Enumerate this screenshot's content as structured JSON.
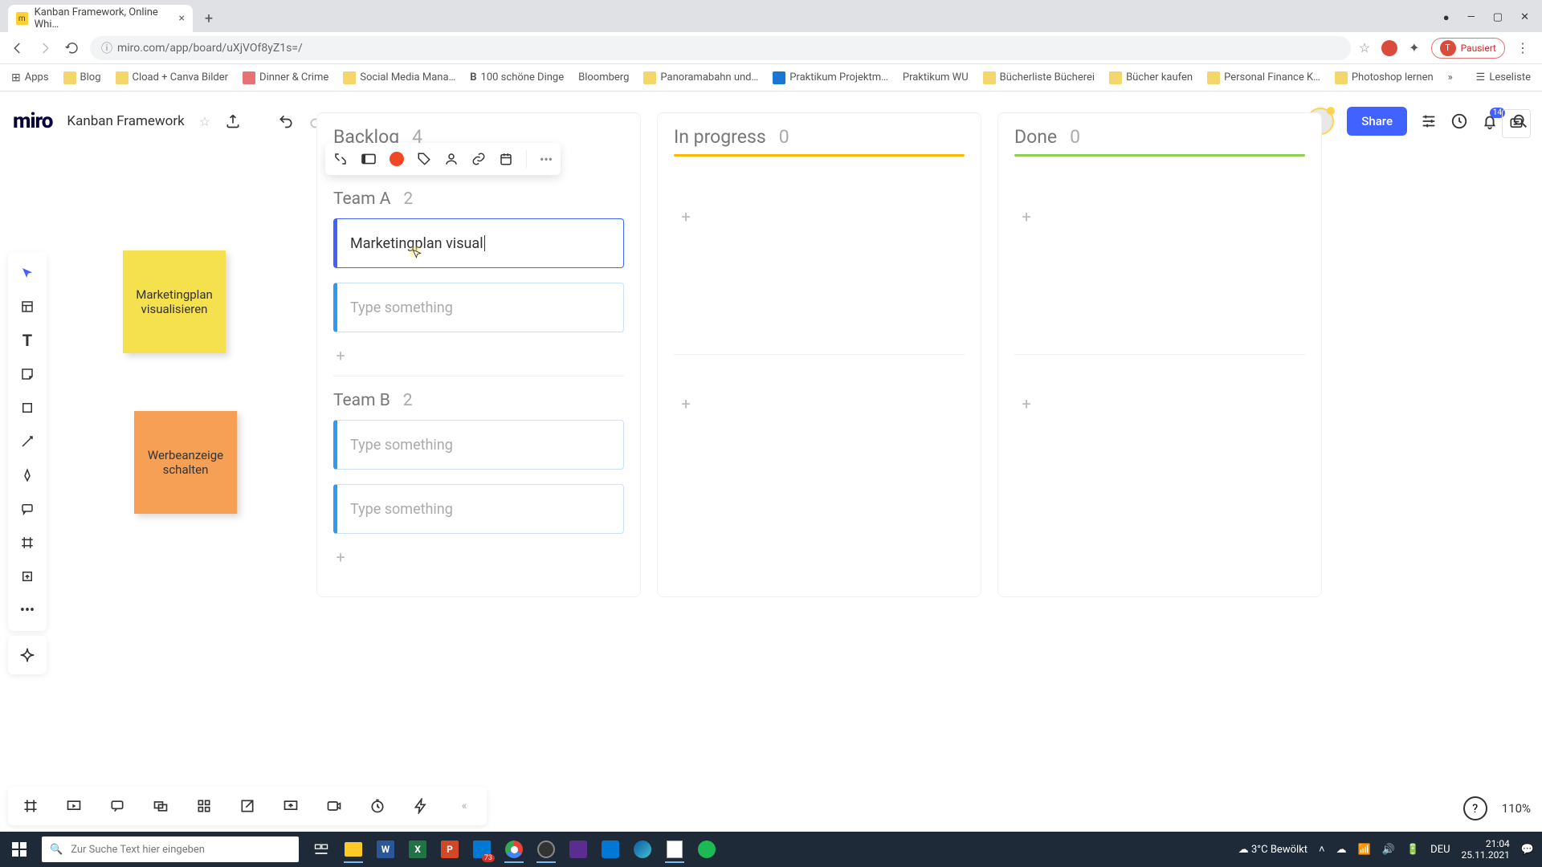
{
  "browser": {
    "tab_title": "Kanban Framework, Online Whi…",
    "url": "miro.com/app/board/uXjVOf8yZ1s=/",
    "profile_status": "Pausiert",
    "profile_initial": "T",
    "bookmarks": [
      "Apps",
      "Blog",
      "Cload + Canva Bilder",
      "Dinner & Crime",
      "Social Media Mana…",
      "100 schöne Dinge",
      "Bloomberg",
      "Panoramabahn und…",
      "Praktikum Projektm…",
      "Praktikum WU",
      "Bücherliste Bücherei",
      "Bücher kaufen",
      "Personal Finance K…",
      "Photoshop lernen"
    ],
    "reading_list": "Leseliste"
  },
  "app": {
    "logo": "miro",
    "board_title": "Kanban Framework",
    "share_label": "Share",
    "notification_count": "14",
    "zoom": "110%"
  },
  "stickies": {
    "yellow": "Marketingplan visualisieren",
    "orange": "Werbeanzeige schalten"
  },
  "kanban": {
    "columns": [
      {
        "title": "Backlog",
        "count": "4"
      },
      {
        "title": "In progress",
        "count": "0"
      },
      {
        "title": "Done",
        "count": "0"
      }
    ],
    "groups": [
      {
        "title": "Team A",
        "count": "2"
      },
      {
        "title": "Team B",
        "count": "2"
      }
    ],
    "cards": {
      "a1_text": "Marketingplan visual",
      "placeholder": "Type something"
    }
  },
  "taskbar": {
    "search_placeholder": "Zur Suche Text hier eingeben",
    "weather_temp": "3°C",
    "weather_desc": "Bewölkt",
    "lang": "DEU",
    "time": "21:04",
    "date": "25.11.2021",
    "mail_badge": "73"
  }
}
